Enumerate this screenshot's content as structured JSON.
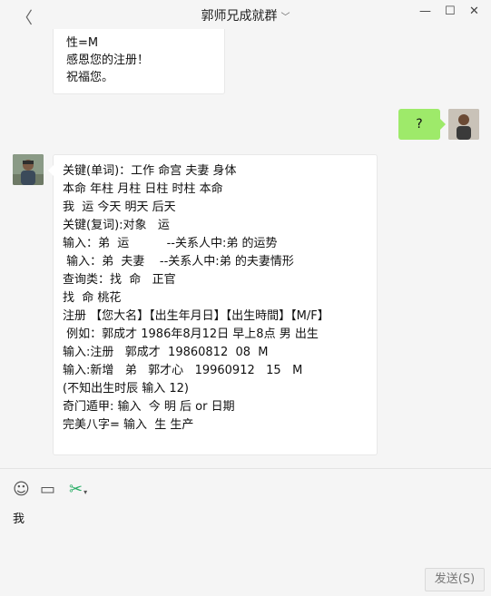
{
  "window": {
    "title": "郭师兄成就群",
    "back_glyph": "〈",
    "caret_glyph": "﹀",
    "minimize_glyph": "—",
    "maximize_glyph": "☐",
    "close_glyph": "✕"
  },
  "messages": {
    "top_bubble": {
      "lines": [
        "性=M",
        "感恩您的注册！",
        "祝福您。"
      ]
    },
    "self_bubble": {
      "text": "?"
    },
    "main_bubble": {
      "lines": [
        "关键(单词)：工作 命宫 夫妻 身体",
        "本命 年柱 月柱 日柱 时柱 本命",
        "我  运 今天 明天 后天",
        "关键(复词):对象   运",
        "输入：弟  运          --关系人中:弟 的运势",
        " 输入：弟  夫妻    --关系人中:弟 的夫妻情形",
        "查询类：找  命   正官",
        "找  命 桃花",
        "注册 【您大名】【出生年月日】【出生時間】【M/F】",
        " 例如：郭成才 1986年8月12日 早上8点 男 出生",
        "输入:注册   郭成才  19860812  08  M",
        "输入:新增   弟   郭才心   19960912   15   M",
        "(不知出生时辰 输入 12)",
        "奇门遁甲: 输入  今 明 后 or 日期",
        "完美八字= 输入  生 生产"
      ]
    }
  },
  "composer": {
    "emoji_icon": "☺",
    "folder_icon": "▭",
    "scissors_icon": "✂",
    "dropdown_glyph": "▾",
    "draft_text": "我",
    "send_label": "发送(S)"
  },
  "colors": {
    "self_bubble": "#9eea6a",
    "background": "#f5f5f5",
    "scissors": "#2aae67"
  }
}
